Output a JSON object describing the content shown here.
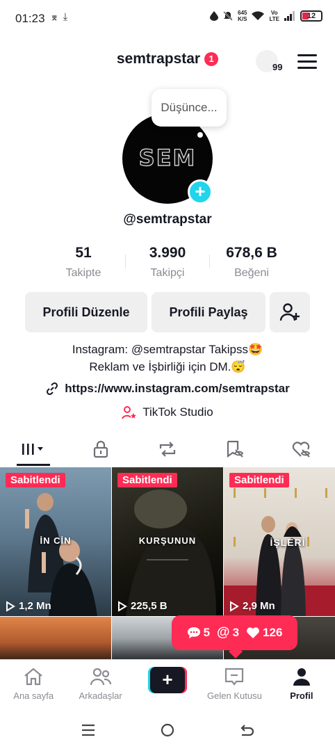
{
  "status_bar": {
    "time": "01:23",
    "net_speed": "645",
    "net_unit": "K/S",
    "vo": "Vo",
    "lte": "LTE",
    "battery": "12"
  },
  "header": {
    "username": "semtrapstar",
    "notification_count": "1",
    "story_count": "99"
  },
  "avatar": {
    "thought_text": "Düşünce...",
    "logo_text": "SEM"
  },
  "handle": "@semtrapstar",
  "stats": [
    {
      "value": "51",
      "label": "Takipte"
    },
    {
      "value": "3.990",
      "label": "Takipçi"
    },
    {
      "value": "678,6 B",
      "label": "Beğeni"
    }
  ],
  "buttons": {
    "edit": "Profili Düzenle",
    "share": "Profili Paylaş"
  },
  "bio": {
    "line1": "Instagram: @semtrapstar Takipss🤩",
    "line2": "Reklam ve İşbirliği için DM.😴"
  },
  "link": "https://www.instagram.com/semtrapstar",
  "studio": "TikTok Studio",
  "videos": [
    {
      "pinned": "Sabitlendi",
      "views": "1,2 Mn",
      "overlay": "İN CİN"
    },
    {
      "pinned": "Sabitlendi",
      "views": "225,5 B",
      "overlay": "KURŞUNUN"
    },
    {
      "pinned": "Sabitlendi",
      "views": "2,9 Mn",
      "overlay": "İŞLERİ"
    }
  ],
  "activity": {
    "comments": "5",
    "mentions": "3",
    "likes": "126"
  },
  "bottom_nav": {
    "home": "Ana sayfa",
    "friends": "Arkadaşlar",
    "inbox": "Gelen Kutusu",
    "profile": "Profil"
  },
  "colors": {
    "accent": "#fe2c55",
    "cyan": "#20d5ec",
    "text": "#161823",
    "muted": "#8a8b91"
  }
}
